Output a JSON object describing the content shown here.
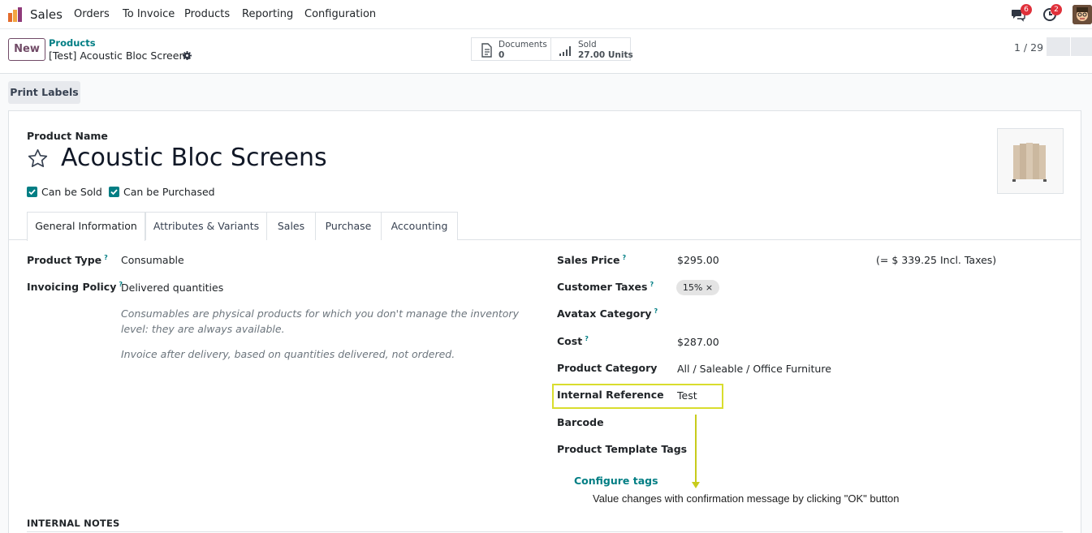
{
  "navbar": {
    "app_name": "Sales",
    "menu": [
      "Orders",
      "To Invoice",
      "Products",
      "Reporting",
      "Configuration"
    ],
    "chat_badge": "6",
    "activity_badge": "2"
  },
  "control": {
    "new_label": "New",
    "breadcrumb_parent": "Products",
    "breadcrumb_current": "[Test] Acoustic Bloc Screens",
    "documents_label": "Documents",
    "documents_value": "0",
    "sold_label": "Sold",
    "sold_value": "27.00 Units",
    "pager": "1 / 29"
  },
  "actions": {
    "print_labels": "Print Labels"
  },
  "form": {
    "product_name_label": "Product Name",
    "product_name": "Acoustic Bloc Screens",
    "can_be_sold": "Can be Sold",
    "can_be_purchased": "Can be Purchased",
    "tabs": [
      "General Information",
      "Attributes & Variants",
      "Sales",
      "Purchase",
      "Accounting"
    ],
    "left": {
      "product_type_label": "Product Type",
      "product_type": "Consumable",
      "invoicing_policy_label": "Invoicing Policy",
      "invoicing_policy": "Delivered quantities",
      "help_1": "Consumables are physical products for which you don't manage the inventory level: they are always available.",
      "help_2": "Invoice after delivery, based on quantities delivered, not ordered."
    },
    "right": {
      "sales_price_label": "Sales Price",
      "sales_price": "$295.00",
      "incl_taxes": "(= $ 339.25 Incl. Taxes)",
      "customer_taxes_label": "Customer Taxes",
      "customer_tax_tag": "15% ×",
      "avatax_label": "Avatax Category",
      "cost_label": "Cost",
      "cost": "$287.00",
      "category_label": "Product Category",
      "category": "All / Saleable / Office Furniture",
      "internal_ref_label": "Internal Reference",
      "internal_ref": "Test",
      "barcode_label": "Barcode",
      "template_tags_label": "Product Template Tags",
      "configure_tags": "Configure tags"
    },
    "notes_label": "INTERNAL NOTES"
  },
  "annotation": "Value changes with confirmation message by clicking \"OK\" button",
  "colors": {
    "brand": "#714b67",
    "accent": "#017e84",
    "highlight": "#d9dd2e",
    "badge": "#e0303a"
  }
}
